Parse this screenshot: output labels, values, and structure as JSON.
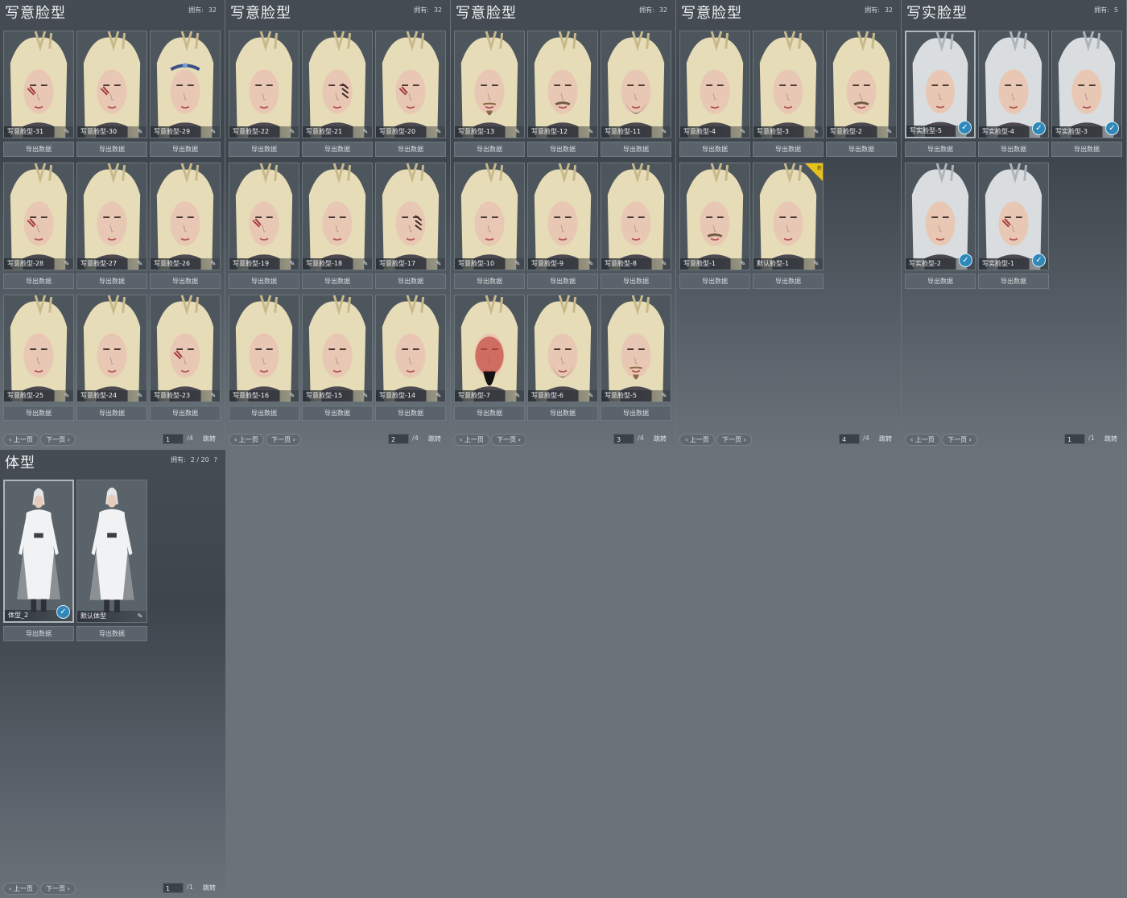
{
  "panels": [
    {
      "title": "写意脸型",
      "count_label": "拥有:",
      "count": "32",
      "cards": [
        {
          "label": "写意脸型-31",
          "hair": "blonde",
          "mark": "scar"
        },
        {
          "label": "写意脸型-30",
          "hair": "blonde",
          "mark": "scar"
        },
        {
          "label": "写意脸型-29",
          "hair": "blonde",
          "mark": "circlet"
        },
        {
          "label": "写意脸型-28",
          "hair": "blonde",
          "mark": "scar"
        },
        {
          "label": "写意脸型-27",
          "hair": "blonde",
          "mark": "none"
        },
        {
          "label": "写意脸型-26",
          "hair": "blonde",
          "mark": "none"
        },
        {
          "label": "写意脸型-25",
          "hair": "blonde",
          "mark": "none"
        },
        {
          "label": "写意脸型-24",
          "hair": "blonde",
          "mark": "none"
        },
        {
          "label": "写意脸型-23",
          "hair": "blonde",
          "mark": "scar"
        }
      ],
      "page": "1",
      "total": "/4"
    },
    {
      "title": "写意脸型",
      "count_label": "拥有:",
      "count": "32",
      "cards": [
        {
          "label": "写意脸型-22",
          "hair": "blonde",
          "mark": "none"
        },
        {
          "label": "写意脸型-21",
          "hair": "blonde",
          "mark": "stripes"
        },
        {
          "label": "写意脸型-20",
          "hair": "blonde",
          "mark": "scar"
        },
        {
          "label": "写意脸型-19",
          "hair": "blonde",
          "mark": "scar"
        },
        {
          "label": "写意脸型-18",
          "hair": "blonde",
          "mark": "none"
        },
        {
          "label": "写意脸型-17",
          "hair": "blonde",
          "mark": "stripes"
        },
        {
          "label": "写意脸型-16",
          "hair": "blonde",
          "mark": "none"
        },
        {
          "label": "写意脸型-15",
          "hair": "blonde",
          "mark": "none"
        },
        {
          "label": "写意脸型-14",
          "hair": "blonde",
          "mark": "none"
        }
      ],
      "page": "2",
      "total": "/4"
    },
    {
      "title": "写意脸型",
      "count_label": "拥有:",
      "count": "32",
      "cards": [
        {
          "label": "写意脸型-13",
          "hair": "blonde",
          "mark": "goatee"
        },
        {
          "label": "写意脸型-12",
          "hair": "blonde",
          "mark": "mustache"
        },
        {
          "label": "写意脸型-11",
          "hair": "blonde",
          "mark": "beard"
        },
        {
          "label": "写意脸型-10",
          "hair": "blonde",
          "mark": "none"
        },
        {
          "label": "写意脸型-9",
          "hair": "blonde",
          "mark": "none"
        },
        {
          "label": "写意脸型-8",
          "hair": "blonde",
          "mark": "none"
        },
        {
          "label": "写意脸型-7",
          "hair": "blonde",
          "mark": "redface"
        },
        {
          "label": "写意脸型-6",
          "hair": "blonde",
          "mark": "beard"
        },
        {
          "label": "写意脸型-5",
          "hair": "blonde",
          "mark": "goatee"
        }
      ],
      "page": "3",
      "total": "/4"
    },
    {
      "title": "写意脸型",
      "count_label": "拥有:",
      "count": "32",
      "cards": [
        {
          "label": "写意脸型-4",
          "hair": "blonde",
          "mark": "none"
        },
        {
          "label": "写意脸型-3",
          "hair": "blonde",
          "mark": "none"
        },
        {
          "label": "写意脸型-2",
          "hair": "blonde",
          "mark": "mustache"
        },
        {
          "label": "写意脸型-1",
          "hair": "blonde",
          "mark": "mustache"
        },
        {
          "label": "默认脸型-1",
          "hair": "blonde",
          "mark": "none",
          "badge": "新"
        }
      ],
      "page": "4",
      "total": "/4"
    },
    {
      "title": "写实脸型",
      "count_label": "拥有:",
      "count": "5",
      "cards": [
        {
          "label": "写实脸型-5",
          "hair": "silver",
          "mark": "none",
          "selected": true,
          "check": true
        },
        {
          "label": "写实脸型-4",
          "hair": "silver",
          "mark": "none",
          "check": true
        },
        {
          "label": "写实脸型-3",
          "hair": "silver",
          "mark": "none",
          "check": true
        },
        {
          "label": "写实脸型-2",
          "hair": "silver",
          "mark": "none",
          "check": true
        },
        {
          "label": "写实脸型-1",
          "hair": "silver",
          "mark": "scar",
          "check": true
        }
      ],
      "page": "1",
      "total": "/1"
    }
  ],
  "body_panel": {
    "title": "体型",
    "count_label": "拥有:",
    "count": "2 / 20",
    "help": "?",
    "cards": [
      {
        "label": "体型_2",
        "selected": true,
        "check": true
      },
      {
        "label": "默认体型"
      }
    ],
    "page": "1",
    "total": "/1"
  },
  "labels": {
    "export": "导出数据",
    "prev": "上一页",
    "next": "下一页",
    "jump": "跳转"
  },
  "icons": {
    "edit": "pencil-icon",
    "equipped": "check-circle-icon",
    "prev": "chevron-left-icon",
    "next": "chevron-right-icon"
  },
  "colors": {
    "page_bg": "#6b737a",
    "accent_check": "#2f88b9",
    "badge": "#e6c21c"
  }
}
